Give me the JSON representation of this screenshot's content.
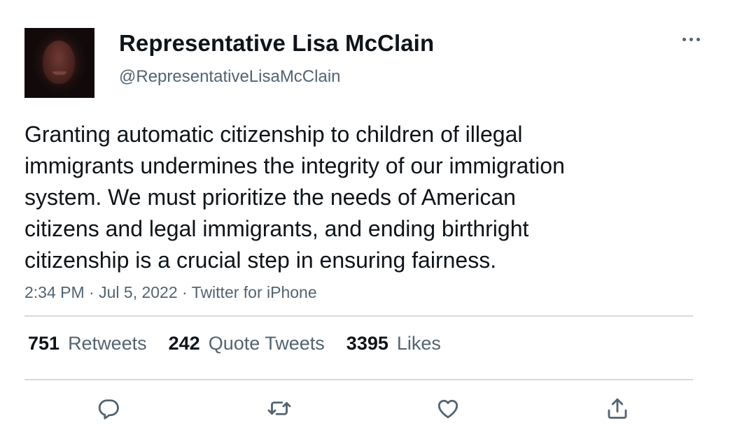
{
  "author": {
    "display_name": "Representative Lisa McClain",
    "handle": "@RepresentativeLisaMcClain"
  },
  "tweet": {
    "text": "Granting automatic citizenship to children of illegal\nimmigrants undermines the integrity of our immigration\nsystem. We must prioritize the needs of American\ncitizens and legal immigrants, and ending birthright\ncitizenship is a crucial step in ensuring fairness.",
    "time": "2:34 PM",
    "date": "Jul 5, 2022",
    "source": "Twitter for iPhone",
    "separator": " · "
  },
  "stats": {
    "retweets_count": "751",
    "retweets_label": "Retweets",
    "quotes_count": "242",
    "quotes_label": "Quote Tweets",
    "likes_count": "3395",
    "likes_label": "Likes"
  },
  "icons": {
    "more": "more-horizontal-icon",
    "reply": "reply-icon",
    "retweet": "retweet-icon",
    "like": "heart-icon",
    "share": "share-icon"
  },
  "colors": {
    "text_primary": "#0f1419",
    "text_secondary": "#536471",
    "divider": "#d9d9d9",
    "background": "#ffffff"
  }
}
